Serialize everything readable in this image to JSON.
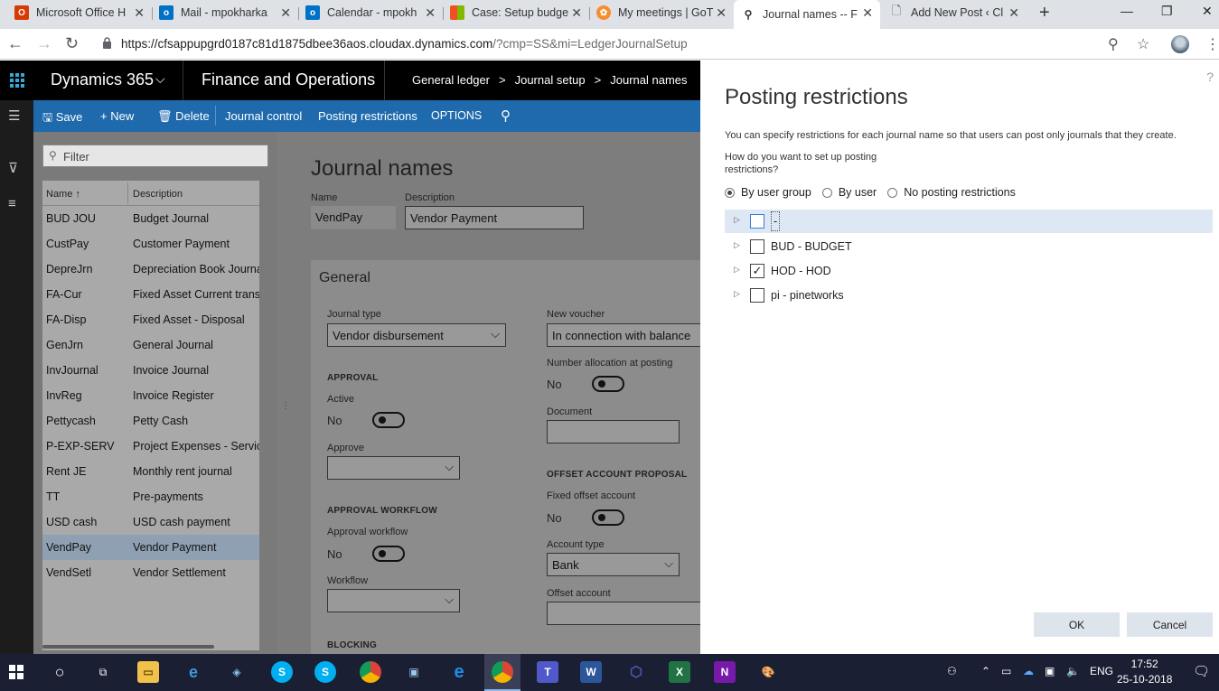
{
  "browser": {
    "tabs": [
      {
        "label": "Microsoft Office H",
        "icon": "office-icon",
        "color": "#d83b01"
      },
      {
        "label": "Mail - mpokharka",
        "icon": "outlook-icon",
        "color": "#0072c6"
      },
      {
        "label": "Calendar - mpokh",
        "icon": "outlook-icon",
        "color": "#0072c6"
      },
      {
        "label": "Case: Setup budge",
        "icon": "microsoft-icon",
        "color": "#f25022"
      },
      {
        "label": "My meetings | GoT",
        "icon": "gotomeeting-icon",
        "color": "#f68d2e"
      },
      {
        "label": "Journal names -- F",
        "icon": "dynamics-icon",
        "color": "#002050"
      },
      {
        "label": "Add New Post ‹ Cl",
        "icon": "page-icon",
        "color": "#888888"
      }
    ],
    "url_host": "https://cfsappupgrd0187c81d1875dbee36aos.cloudax.dynamics.com",
    "url_path": "/?cmp=SS&mi=LedgerJournalSetup"
  },
  "d365": {
    "brand": "Dynamics 365",
    "app": "Finance and Operations",
    "breadcrumb": [
      "General ledger",
      ">",
      "Journal setup",
      ">",
      "Journal names"
    ]
  },
  "actions": {
    "save": "Save",
    "new": "New",
    "delete": "Delete",
    "journal_control": "Journal control",
    "posting_restrictions": "Posting restrictions",
    "options": "OPTIONS"
  },
  "list": {
    "filter_placeholder": "Filter",
    "col_name": "Name ↑",
    "col_desc": "Description",
    "rows": [
      {
        "name": "BUD JOU",
        "desc": "Budget Journal"
      },
      {
        "name": "CustPay",
        "desc": "Customer Payment"
      },
      {
        "name": "DepreJrn",
        "desc": "Depreciation Book Journa"
      },
      {
        "name": "FA-Cur",
        "desc": "Fixed Asset Current trans"
      },
      {
        "name": "FA-Disp",
        "desc": "Fixed Asset - Disposal"
      },
      {
        "name": "GenJrn",
        "desc": "General Journal"
      },
      {
        "name": "InvJournal",
        "desc": "Invoice Journal"
      },
      {
        "name": "InvReg",
        "desc": "Invoice Register"
      },
      {
        "name": "Pettycash",
        "desc": "Petty Cash"
      },
      {
        "name": "P-EXP-SERV",
        "desc": "Project Expenses - Servic"
      },
      {
        "name": "Rent JE",
        "desc": "Monthly rent journal"
      },
      {
        "name": "TT",
        "desc": "Pre-payments"
      },
      {
        "name": "USD cash",
        "desc": "USD cash payment"
      },
      {
        "name": "VendPay",
        "desc": "Vendor Payment"
      },
      {
        "name": "VendSetl",
        "desc": "Vendor Settlement"
      }
    ],
    "selected_index": 13
  },
  "details": {
    "title": "Journal names",
    "name_label": "Name",
    "name_value": "VendPay",
    "desc_label": "Description",
    "desc_value": "Vendor Payment",
    "general": "General",
    "journal_type_label": "Journal type",
    "journal_type_value": "Vendor disbursement",
    "new_voucher_label": "New voucher",
    "new_voucher_value": "In connection with balance",
    "approval_hdr": "APPROVAL",
    "active_label": "Active",
    "active_value": "No",
    "num_alloc_label": "Number allocation at posting",
    "num_alloc_value": "No",
    "approve_label": "Approve",
    "document_label": "Document",
    "offset_hdr": "OFFSET ACCOUNT PROPOSAL",
    "fixed_offset_label": "Fixed offset account",
    "fixed_offset_value": "No",
    "approval_wf_hdr": "APPROVAL WORKFLOW",
    "approval_wf_label": "Approval workflow",
    "approval_wf_value": "No",
    "account_type_label": "Account type",
    "account_type_value": "Bank",
    "workflow_label": "Workflow",
    "offset_account_label": "Offset account",
    "blocking_hdr": "BLOCKING"
  },
  "dialog": {
    "help": "?",
    "title": "Posting restrictions",
    "description": "You can specify restrictions for each journal name so that users can post only journals that they create.",
    "question": "How do you want to set up posting restrictions?",
    "options": [
      "By user group",
      "By user",
      "No posting restrictions"
    ],
    "selected_option": 0,
    "tree": [
      {
        "label": "-",
        "checked": false
      },
      {
        "label": "BUD - BUDGET",
        "checked": false
      },
      {
        "label": "HOD - HOD",
        "checked": true
      },
      {
        "label": "pi - pinetworks",
        "checked": false
      }
    ],
    "ok": "OK",
    "cancel": "Cancel"
  },
  "taskbar": {
    "language": "ENG",
    "time": "17:52",
    "date": "25-10-2018"
  },
  "colors": {
    "action_pane": "#1f6aad",
    "d365_bar": "#000000",
    "taskbar": "#1a1f33"
  }
}
